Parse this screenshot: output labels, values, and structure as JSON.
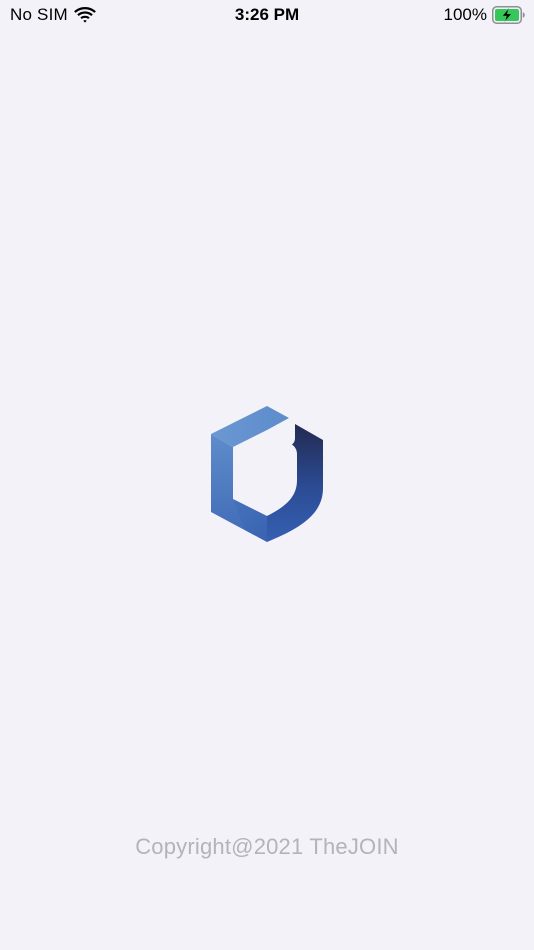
{
  "status_bar": {
    "carrier": "No SIM",
    "time": "3:26 PM",
    "battery_percent": "100%",
    "battery_level": 1.0,
    "charging": true,
    "icons": [
      "wifi-icon",
      "battery-charging-icon"
    ]
  },
  "splash": {
    "logo_icon": "thejoin-logo-icon",
    "copyright": "Copyright@2021 TheJOIN"
  },
  "colors": {
    "background": "#f3f2f8",
    "logo_light": "#6a97d0",
    "logo_mid": "#3f6fbc",
    "logo_dark": "#22305e",
    "battery_green": "#35c759",
    "copyright_text": "#b3b3b8"
  }
}
